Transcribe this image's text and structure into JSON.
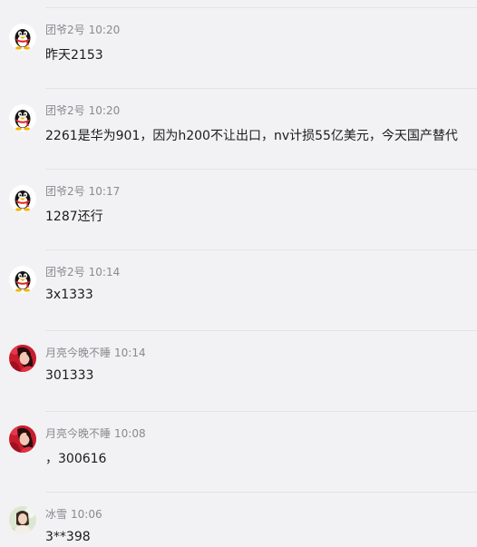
{
  "messages": [
    {
      "sender": "团爷2号",
      "time": "10:20",
      "text": "昨天2153",
      "avatar": "qq-penguin-icon"
    },
    {
      "sender": "团爷2号",
      "time": "10:20",
      "text": "2261是华为901，因为h200不让出口，nv计损55亿美元，今天国产替代",
      "avatar": "qq-penguin-icon"
    },
    {
      "sender": "团爷2号",
      "time": "10:17",
      "text": "1287还行",
      "avatar": "qq-penguin-icon"
    },
    {
      "sender": "团爷2号",
      "time": "10:14",
      "text": "3x1333",
      "avatar": "qq-penguin-icon"
    },
    {
      "sender": "月亮今晚不睡",
      "time": "10:14",
      "text": "301333",
      "avatar": "user-photo-red"
    },
    {
      "sender": "月亮今晚不睡",
      "time": "10:08",
      "text": "，300616",
      "avatar": "user-photo-red"
    },
    {
      "sender": "冰雪",
      "time": "10:06",
      "text": "3**398",
      "avatar": "user-photo-light"
    }
  ],
  "colors": {
    "background": "#f2f2f4",
    "meta": "#8a8a8f",
    "text": "#1b1b1b",
    "divider": "#e3e3e6"
  }
}
